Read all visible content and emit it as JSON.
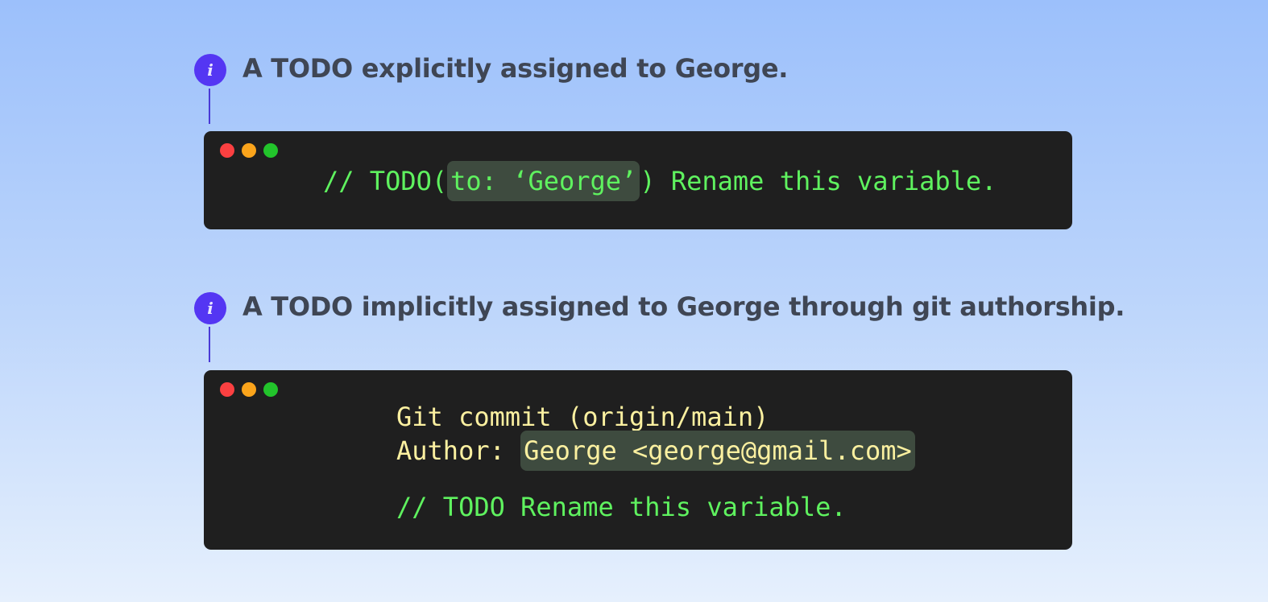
{
  "sections": [
    {
      "icon": "info-icon",
      "icon_glyph": "i",
      "heading": "A TODO explicitly assigned to George.",
      "code": {
        "prefix": "// TODO(",
        "highlight": "to: ‘George’",
        "suffix": ") Rename this variable."
      }
    },
    {
      "icon": "info-icon",
      "icon_glyph": "i",
      "heading": "A TODO implicitly assigned to George through git authorship.",
      "code": {
        "commit_line": "Git commit (origin/main)",
        "author_label": "Author: ",
        "author_highlight": "George <george@gmail.com>",
        "todo_line": "// TODO Rename this variable."
      }
    }
  ],
  "window_controls": [
    "red-dot",
    "yellow-dot",
    "green-dot"
  ],
  "colors": {
    "accent": "#5436f3",
    "terminal_bg": "#1f1f1f",
    "code_green": "#5ff25f",
    "code_yellow": "#fbf0a0",
    "highlight_bg": "#3e4b3f"
  }
}
